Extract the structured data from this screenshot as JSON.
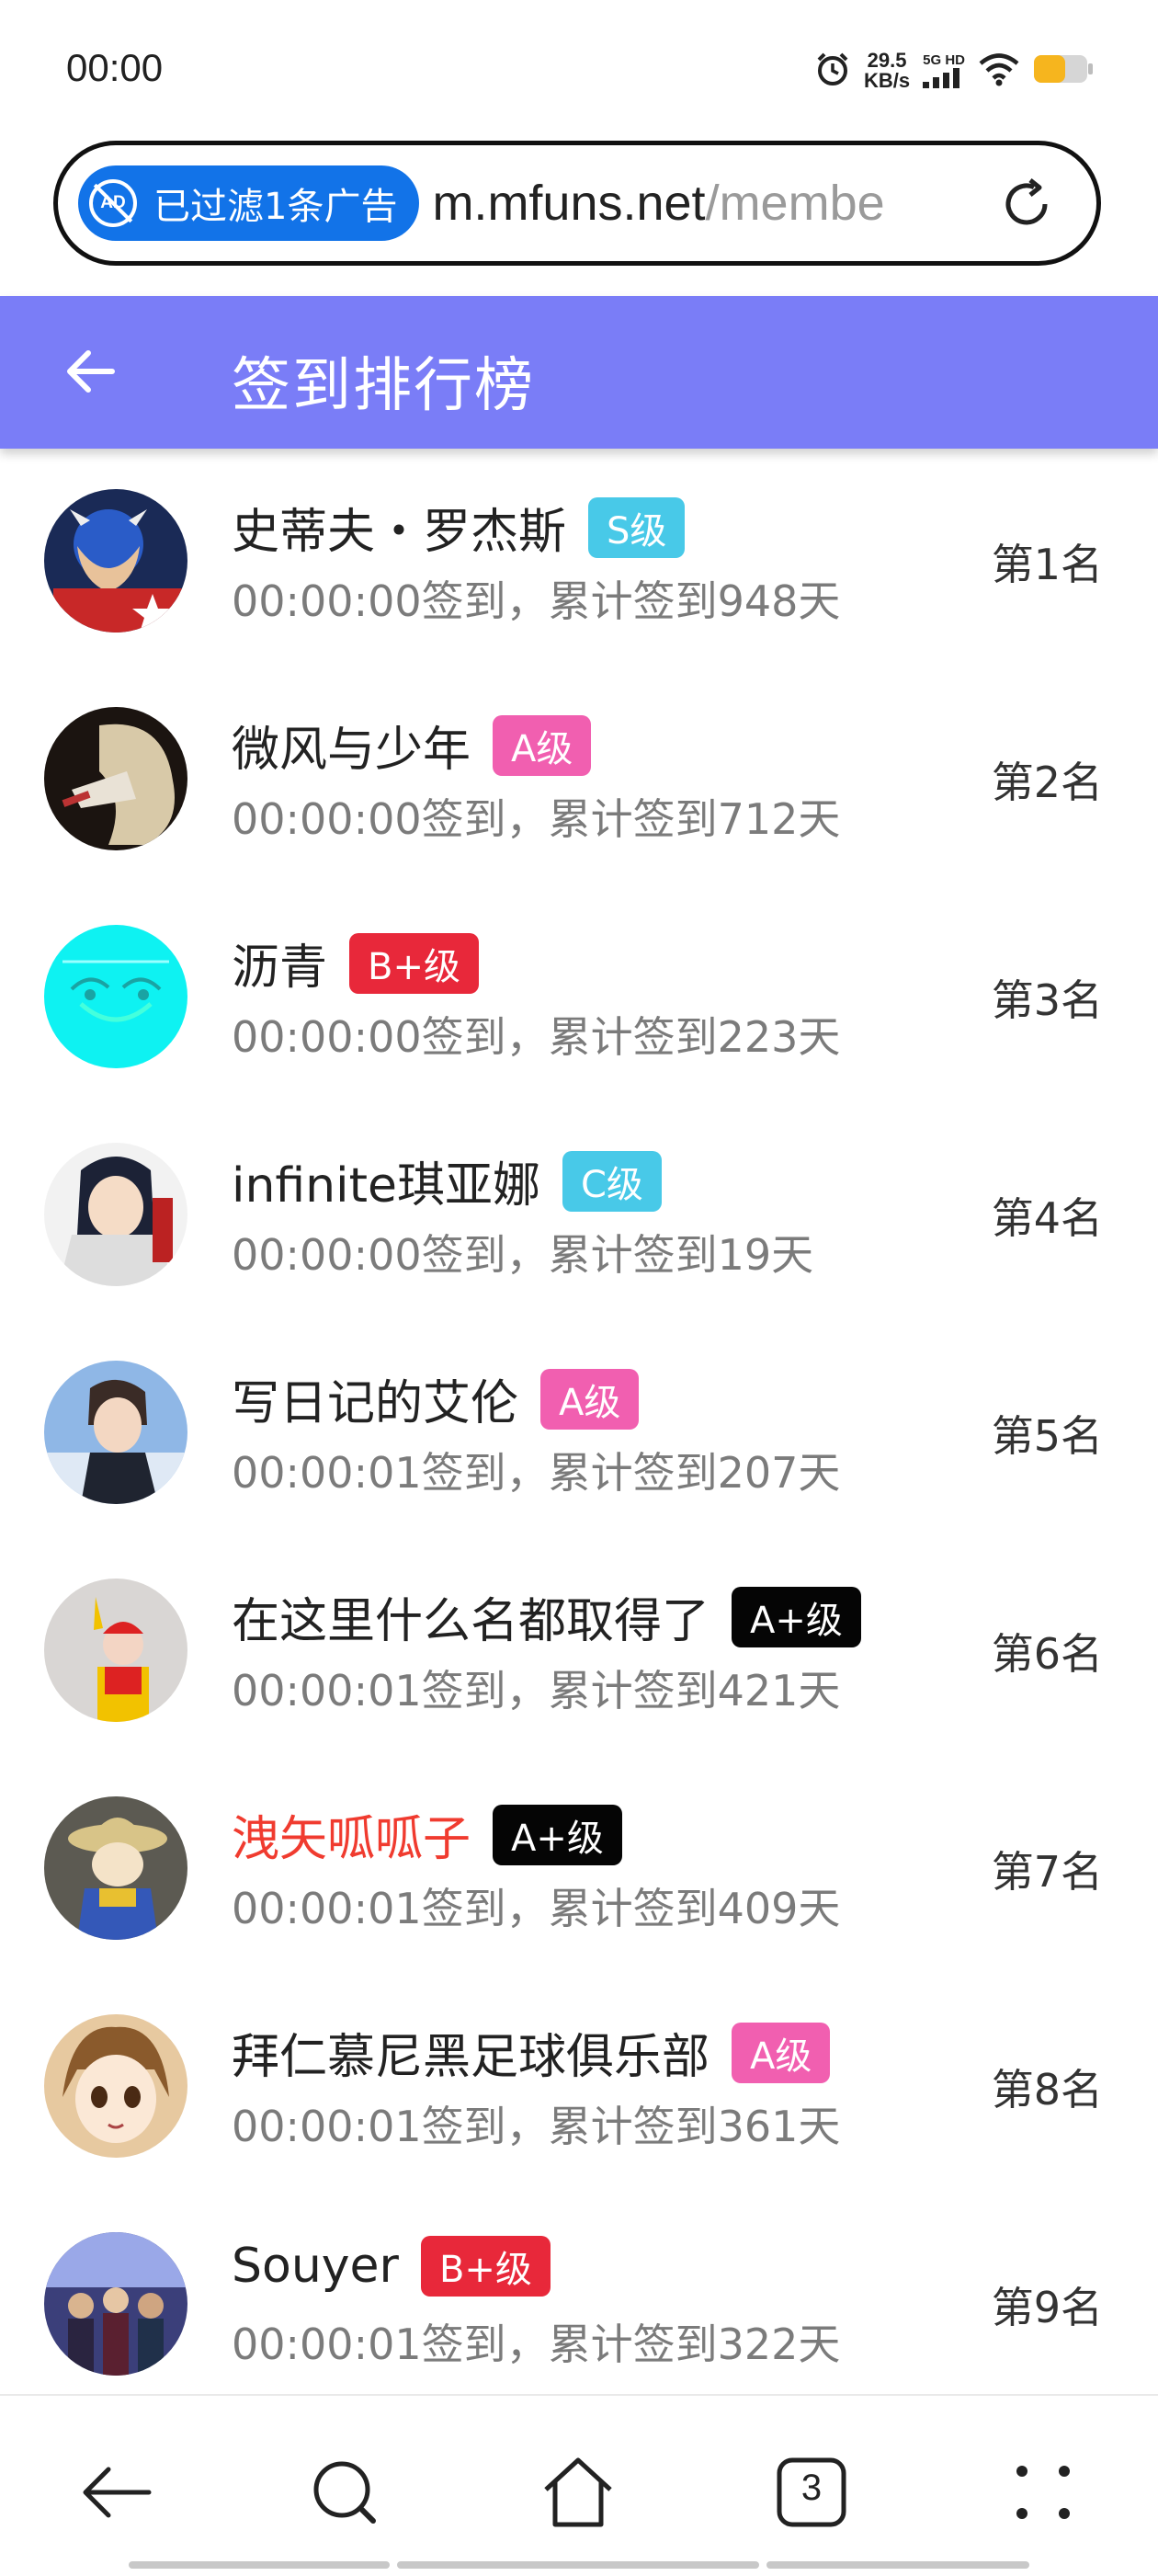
{
  "status_bar": {
    "time": "00:00",
    "net_speed_value": "29.5",
    "net_speed_unit": "KB/s",
    "signal_label": "5G HD"
  },
  "browser": {
    "ad_filter_label": "已过滤1条广告",
    "ad_icon_text": "AD",
    "url_domain": "m.mfuns.net",
    "url_path": "/membe",
    "tab_count": "3"
  },
  "header": {
    "title": "签到排行榜"
  },
  "colors": {
    "header_bg": "#7a7df7",
    "badge_S": "#48c9e8",
    "badge_A": "#f15fb0",
    "badge_B_plus": "#e8283a",
    "badge_C": "#48c9e8",
    "badge_A_plus": "#050505",
    "highlight_name": "#f03b2f",
    "battery": "#f6b51e"
  },
  "ranking": [
    {
      "name": "史蒂夫・罗杰斯",
      "badge": "S级",
      "badge_color": "#48c9e8",
      "meta": "00:00:00签到，累计签到948天",
      "rank": "第1名",
      "avatar_icon": "captain-america-avatar-icon"
    },
    {
      "name": "微风与少年",
      "badge": "A级",
      "badge_color": "#f15fb0",
      "meta": "00:00:00签到，累计签到712天",
      "rank": "第2名",
      "avatar_icon": "anime-character-avatar-icon"
    },
    {
      "name": "沥青",
      "badge": "B+级",
      "badge_color": "#e8283a",
      "meta": "00:00:00签到，累计签到223天",
      "rank": "第3名",
      "avatar_icon": "cyan-sketch-avatar-icon"
    },
    {
      "name": "infinite琪亚娜",
      "badge": "C级",
      "badge_color": "#48c9e8",
      "meta": "00:00:00签到，累计签到19天",
      "rank": "第4名",
      "avatar_icon": "anime-girl-avatar-icon"
    },
    {
      "name": "写日记的艾伦",
      "badge": "A级",
      "badge_color": "#f15fb0",
      "meta": "00:00:01签到，累计签到207天",
      "rank": "第5名",
      "avatar_icon": "anime-boy-avatar-icon"
    },
    {
      "name": "在这里什么名都取得了",
      "badge": "A+级",
      "badge_color": "#050505",
      "meta": "00:00:01签到，累计签到421天",
      "rank": "第6名",
      "avatar_icon": "clown-avatar-icon"
    },
    {
      "name": "洩矢呱呱子",
      "badge": "A+级",
      "badge_color": "#050505",
      "meta": "00:00:01签到，累计签到409天",
      "rank": "第7名",
      "avatar_icon": "figurine-avatar-icon",
      "highlight": true
    },
    {
      "name": "拜仁慕尼黑足球俱乐部",
      "badge": "A级",
      "badge_color": "#f15fb0",
      "meta": "00:00:01签到，累计签到361天",
      "rank": "第8名",
      "avatar_icon": "anime-girl-brown-hair-avatar-icon"
    },
    {
      "name": "Souyer",
      "badge": "B+级",
      "badge_color": "#e8283a",
      "meta": "00:00:01签到，累计签到322天",
      "rank": "第9名",
      "avatar_icon": "group-characters-avatar-icon"
    }
  ],
  "bottom_nav": {
    "items": [
      "back-icon",
      "search-icon",
      "home-icon",
      "tabs-icon",
      "menu-icon"
    ]
  }
}
